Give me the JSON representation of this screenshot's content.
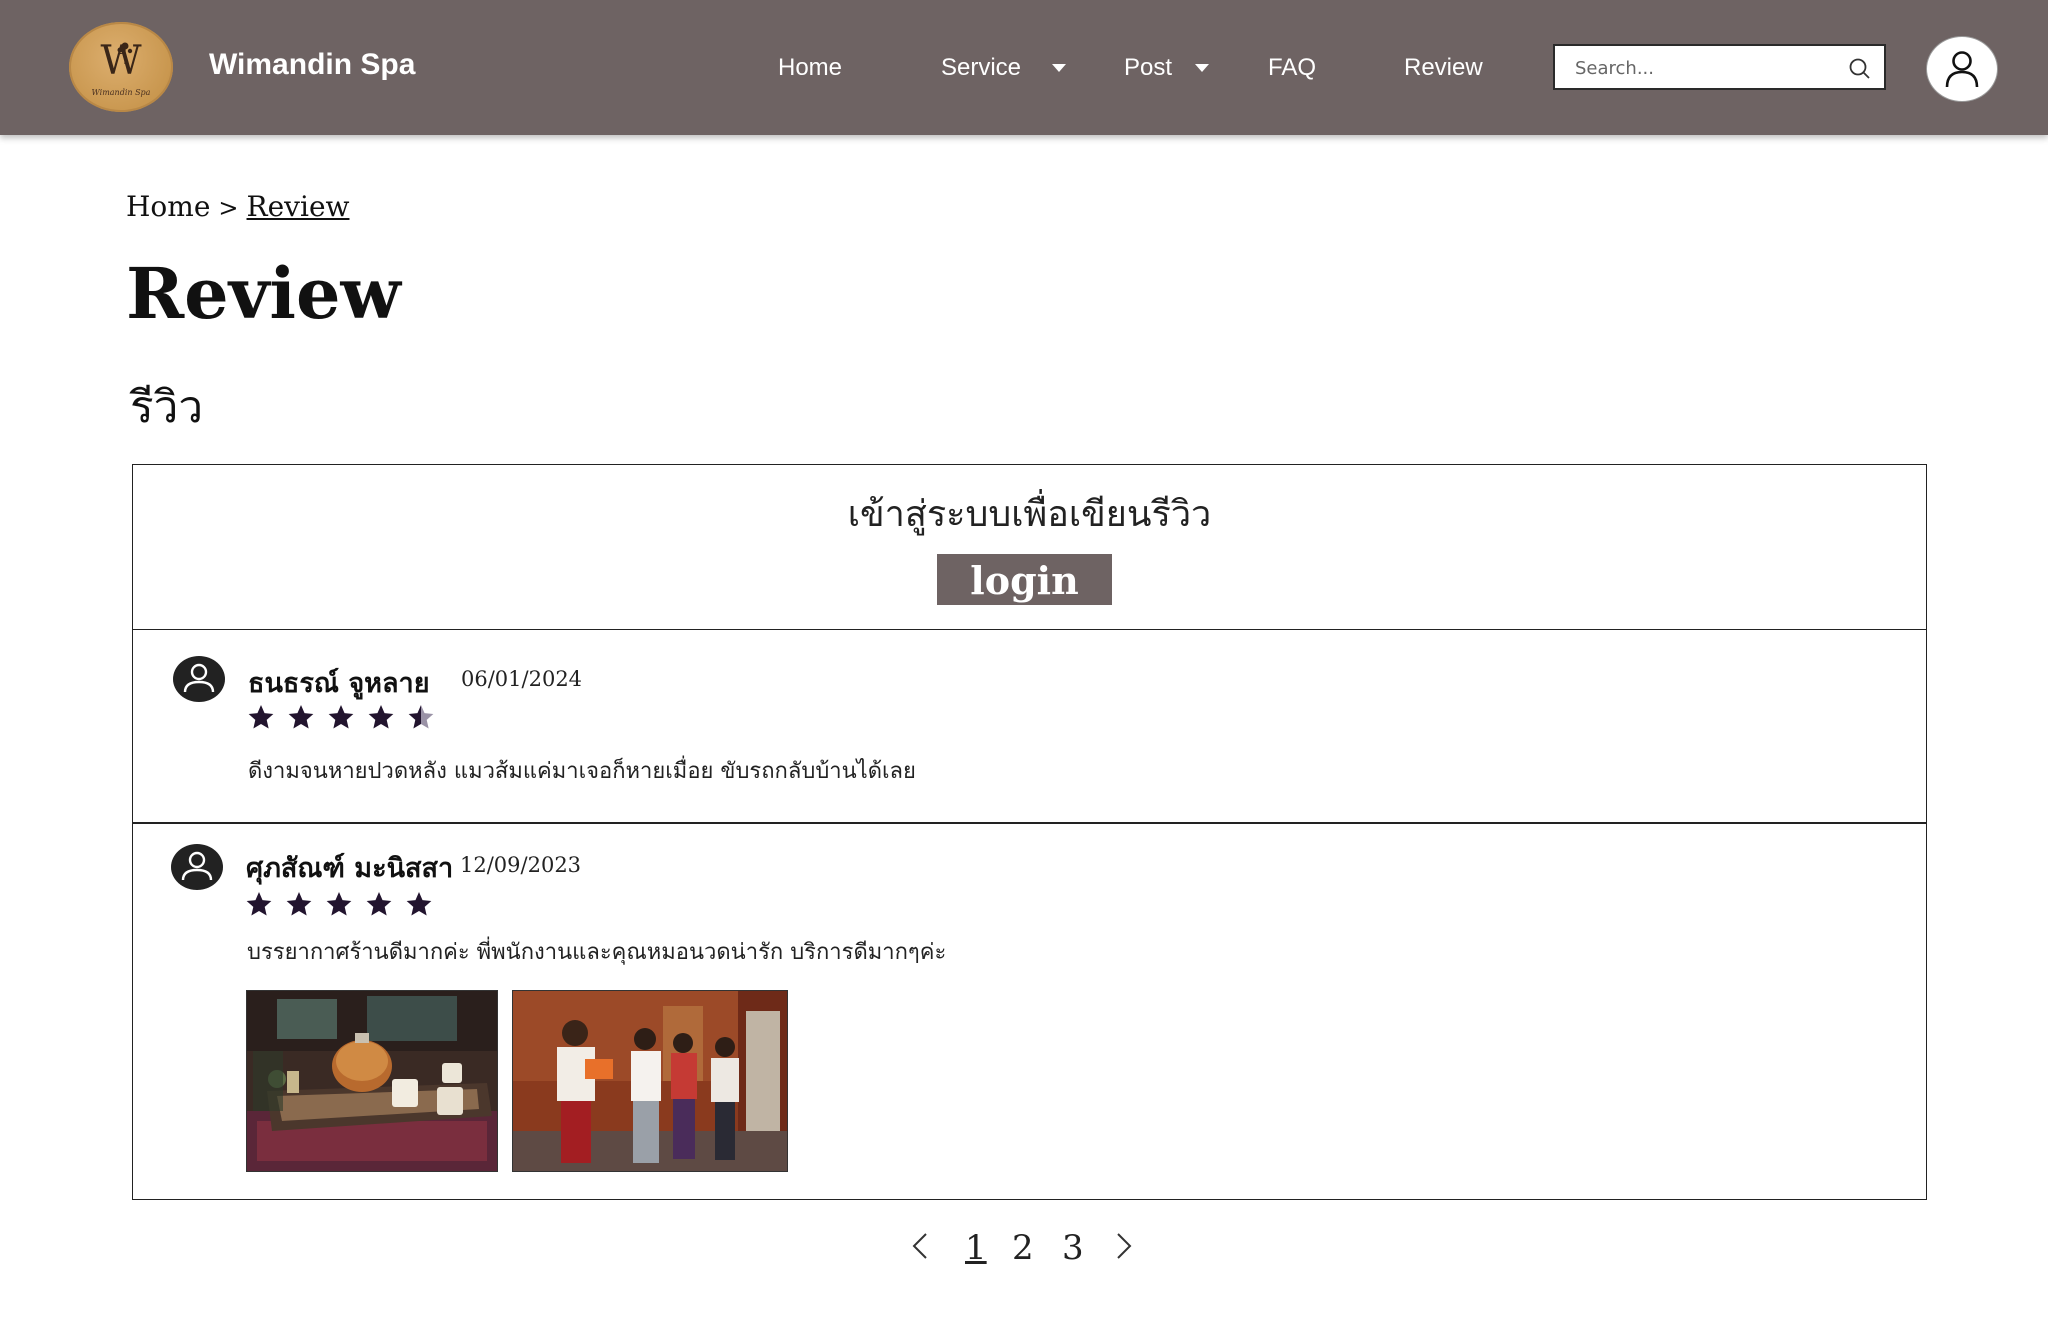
{
  "header": {
    "brand": "Wimandin Spa",
    "logo_letter": "W",
    "logo_small_text": "Wimandin Spa",
    "nav": [
      {
        "label": "Home"
      },
      {
        "label": "Service"
      },
      {
        "label": "Post"
      },
      {
        "label": "FAQ"
      },
      {
        "label": "Review"
      }
    ],
    "search_placeholder": "Search...",
    "bg_color": "#6e6363"
  },
  "breadcrumb": {
    "home": "Home",
    "separator": ">",
    "current": "Review"
  },
  "page": {
    "title": "Review",
    "subtitle": "รีวิว"
  },
  "login": {
    "prompt": "เข้าสู่ระบบเพื่อเขียนรีวิว",
    "button_label": "login"
  },
  "reviews": [
    {
      "name": "ธนธรณ์ จูหลาย",
      "date": "06/01/2024",
      "rating": 4.5,
      "text": "ดีงามจนหายปวดหลัง แมวส้มแค่มาเจอก็หายเมื่อย ขับรถกลับบ้านได้เลย"
    },
    {
      "name": "ศุภสัณฑ์ มะนิสสา",
      "date": "12/09/2023",
      "rating": 5,
      "text": "บรรยากาศร้านดีมากค่ะ พี่พนักงานและคุณหมอนวดน่ารัก บริการดีมากๆค่ะ"
    }
  ],
  "pagination": {
    "pages": [
      "1",
      "2",
      "3"
    ],
    "current": "1"
  },
  "colors": {
    "accent": "#6e6363",
    "star": "#22142e",
    "star_empty": "#9a92a6"
  }
}
